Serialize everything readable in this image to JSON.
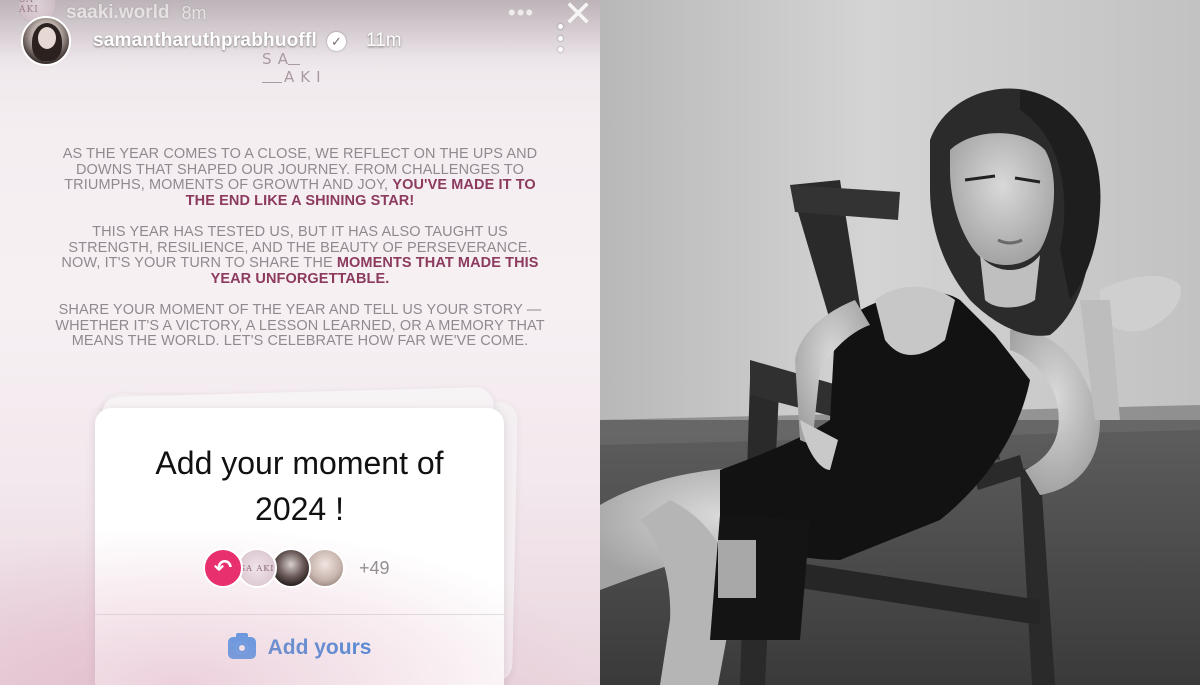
{
  "story": {
    "ghost_header": {
      "username": "saaki.world",
      "time": "8m",
      "avatar_text": "SA AKI"
    },
    "header": {
      "username": "samantharuthprabhuoffl",
      "time": "11m",
      "verified_glyph": "✓"
    },
    "logo": {
      "line1": "SA",
      "line2": "AKI"
    },
    "body": {
      "p1_regular": "As the year comes to a close, we reflect on the ups and downs that shaped our journey. From challenges to triumphs, moments of growth and joy,",
      "p1_bold": "you've made it to the end like a shining star!",
      "p2_regular": "This year has tested us, but it has also taught us strength, resilience, and the beauty of perseverance. Now, it's your turn to share the",
      "p2_bold": "moments that made this year unforgettable.",
      "p3_regular": "Share your moment of the year and tell us your story — whether it's a victory, a lesson learned, or a memory that means the world. Let's celebrate how far we've come."
    },
    "add_yours_card": {
      "title_line1": "Add your moment of",
      "title_line2": "2024 !",
      "participant_avatar_text": "SA AKI",
      "participants_more": "+49",
      "button_label": "Add yours"
    }
  },
  "icons": {
    "close": "close-icon",
    "more": "more-vertical-icon",
    "verified": "verified-badge-icon",
    "reply": "reply-arrow-icon",
    "camera": "camera-icon"
  },
  "colors": {
    "accent_pink": "#e8306e",
    "emphasis_text": "#8c3a5e",
    "link_blue": "#2e7fd9",
    "camera_blue": "#2e8ff0"
  }
}
